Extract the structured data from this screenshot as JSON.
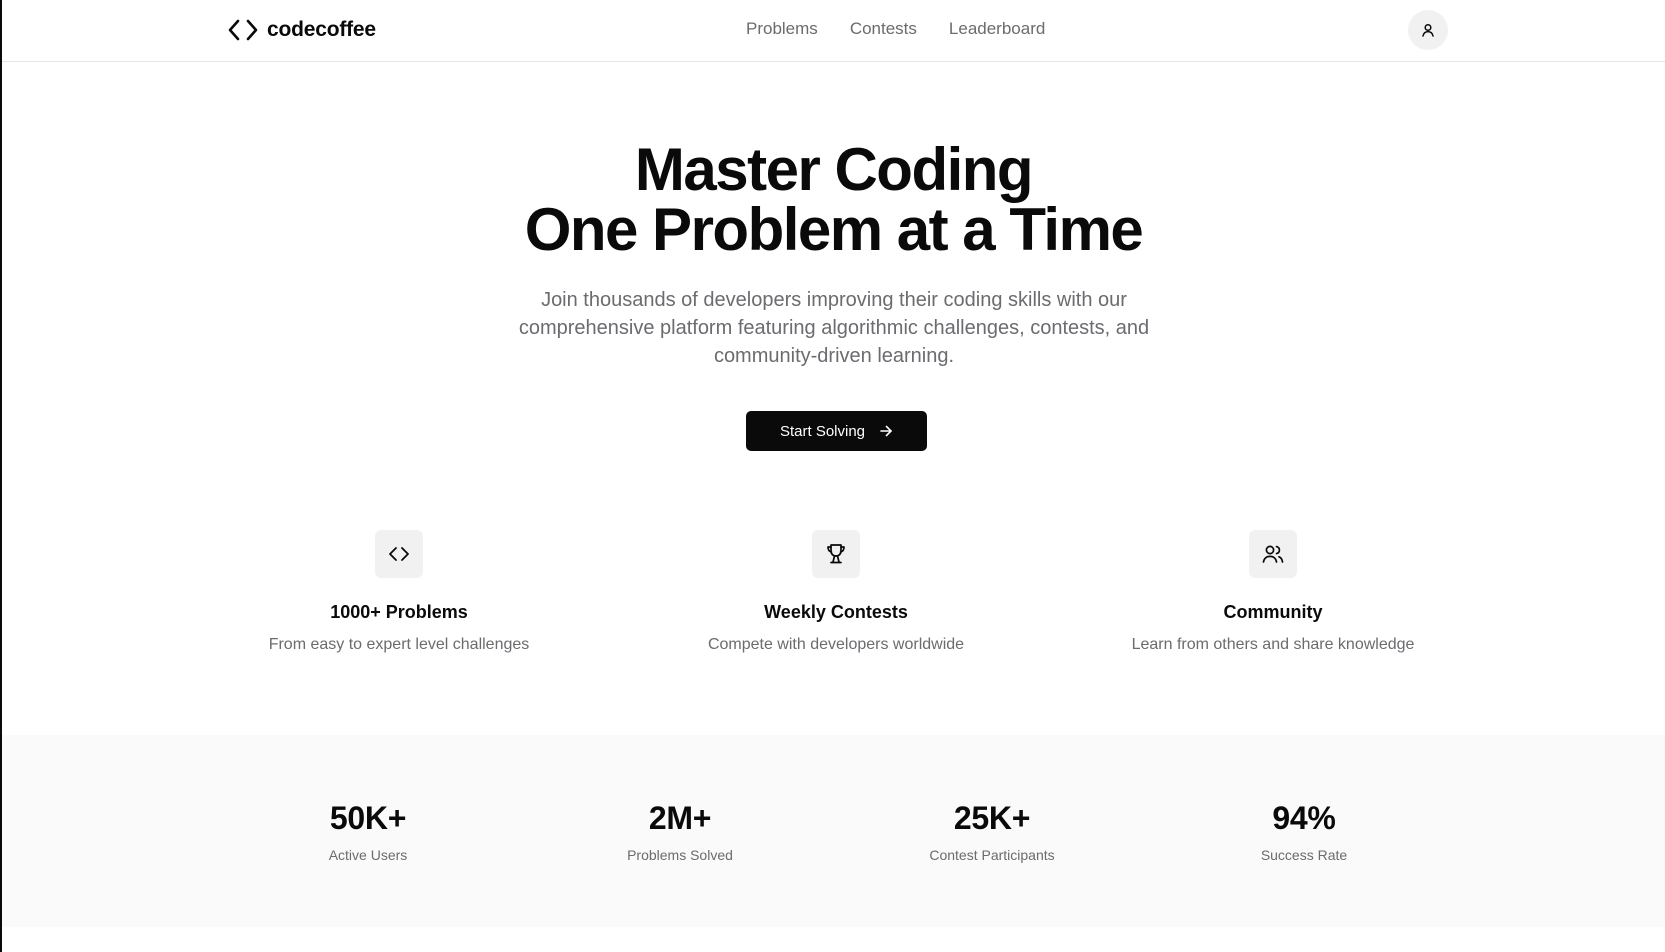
{
  "brand": {
    "name": "codecoffee",
    "icon": "code-brackets-icon"
  },
  "nav": {
    "items": [
      {
        "label": "Problems"
      },
      {
        "label": "Contests"
      },
      {
        "label": "Leaderboard"
      }
    ],
    "user_icon": "user-icon"
  },
  "hero": {
    "title_line1": "Master Coding",
    "title_line2": "One Problem at a Time",
    "subtitle": "Join thousands of developers improving their coding skills with our comprehensive platform featuring algorithmic challenges, contests, and community-driven learning.",
    "cta_label": "Start Solving",
    "cta_icon": "arrow-right-icon"
  },
  "features": [
    {
      "icon": "code-icon",
      "title": "1000+ Problems",
      "description": "From easy to expert level challenges"
    },
    {
      "icon": "trophy-icon",
      "title": "Weekly Contests",
      "description": "Compete with developers worldwide"
    },
    {
      "icon": "users-icon",
      "title": "Community",
      "description": "Learn from others and share knowledge"
    }
  ],
  "stats": [
    {
      "value": "50K+",
      "label": "Active Users"
    },
    {
      "value": "2M+",
      "label": "Problems Solved"
    },
    {
      "value": "25K+",
      "label": "Contest Participants"
    },
    {
      "value": "94%",
      "label": "Success Rate"
    }
  ],
  "colors": {
    "primary": "#0a0a0a",
    "muted_text": "#6b6b70",
    "surface": "#f1f1f2",
    "stats_background": "#fafafa"
  }
}
